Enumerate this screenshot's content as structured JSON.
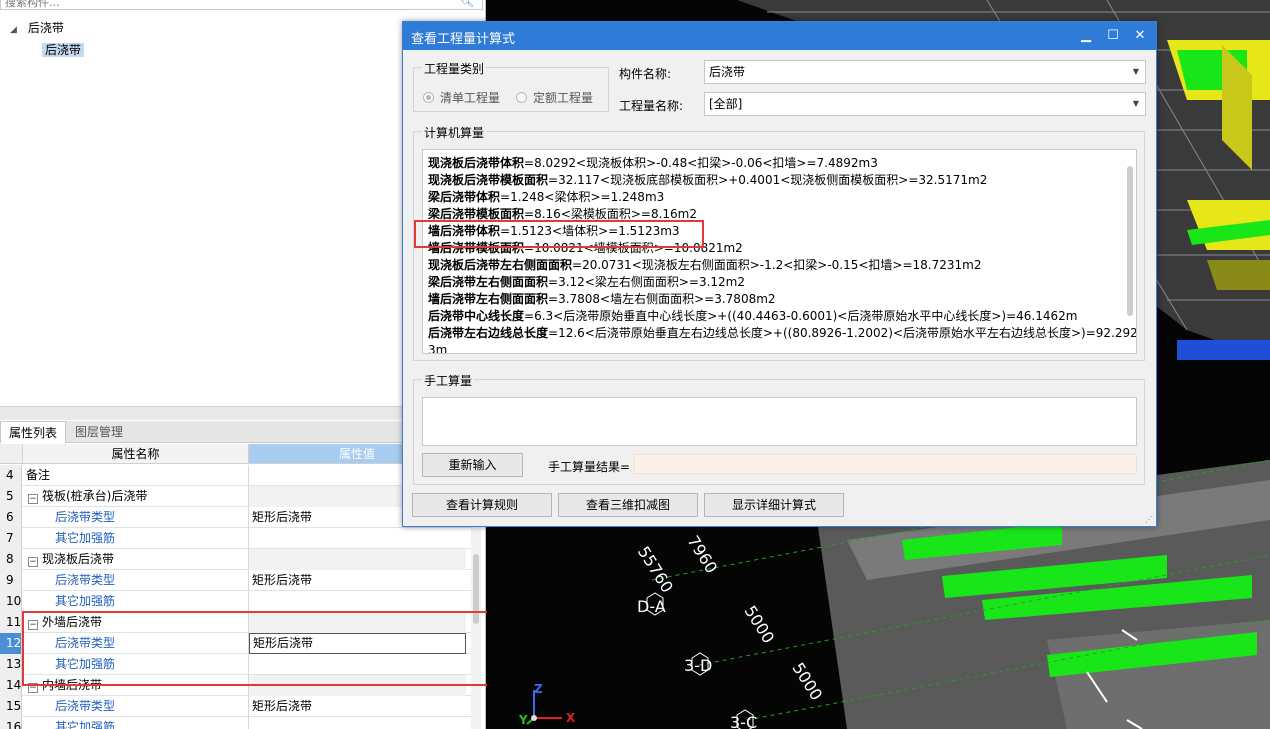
{
  "search": {
    "placeholder": "搜索构件..."
  },
  "tree": {
    "root_label": "后浇带",
    "child_label": "后浇带"
  },
  "tabs": {
    "properties": "属性列表",
    "layers": "图层管理"
  },
  "property_table": {
    "col_name": "属性名称",
    "col_value": "属性值",
    "rows": [
      {
        "num": "4",
        "name": "备注",
        "value": "",
        "kind": "plain"
      },
      {
        "num": "5",
        "name": "筏板(桩承台)后浇带",
        "value": "",
        "kind": "group"
      },
      {
        "num": "6",
        "name": "后浇带类型",
        "value": "矩形后浇带",
        "kind": "child"
      },
      {
        "num": "7",
        "name": "其它加强筋",
        "value": "",
        "kind": "child"
      },
      {
        "num": "8",
        "name": "现浇板后浇带",
        "value": "",
        "kind": "group"
      },
      {
        "num": "9",
        "name": "后浇带类型",
        "value": "矩形后浇带",
        "kind": "child"
      },
      {
        "num": "10",
        "name": "其它加强筋",
        "value": "",
        "kind": "child"
      },
      {
        "num": "11",
        "name": "外墙后浇带",
        "value": "",
        "kind": "group"
      },
      {
        "num": "12",
        "name": "后浇带类型",
        "value": "矩形后浇带",
        "kind": "child-edit"
      },
      {
        "num": "13",
        "name": "其它加强筋",
        "value": "",
        "kind": "child"
      },
      {
        "num": "14",
        "name": "内墙后浇带",
        "value": "",
        "kind": "group"
      },
      {
        "num": "15",
        "name": "后浇带类型",
        "value": "矩形后浇带",
        "kind": "child"
      },
      {
        "num": "16",
        "name": "其它加强筋",
        "value": "",
        "kind": "child"
      }
    ]
  },
  "viewport": {
    "labels": [
      "55760",
      "7960",
      "D-A",
      "5000",
      "3-D",
      "5000",
      "3-C"
    ],
    "axes": {
      "z": "Z",
      "x": "X",
      "y": "Y"
    }
  },
  "dialog": {
    "title": "查看工程量计算式",
    "minimize": "▁",
    "maximize": "☐",
    "close": "✕",
    "quantity_category_label": "工程量类别",
    "radio_list": "清单工程量",
    "radio_quota": "定额工程量",
    "component_name_label": "构件名称:",
    "component_name_value": "后浇带",
    "quantity_name_label": "工程量名称:",
    "quantity_name_value": "[全部]",
    "computer_calc_label": "计算机算量",
    "calc_lines": [
      {
        "term": "现浇板后浇带体积",
        "formula": "=8.0292<现浇板体积>-0.48<扣梁>-0.06<扣墙>=7.4892m3"
      },
      {
        "term": "现浇板后浇带模板面积",
        "formula": "=32.117<现浇板底部模板面积>+0.4001<现浇板侧面模板面积>=32.5171m2"
      },
      {
        "term": "梁后浇带体积",
        "formula": "=1.248<梁体积>=1.248m3"
      },
      {
        "term": "梁后浇带模板面积",
        "formula": "=8.16<梁模板面积>=8.16m2"
      },
      {
        "term": "墙后浇带体积",
        "formula": "=1.5123<墙体积>=1.5123m3"
      },
      {
        "term": "墙后浇带模板面积",
        "formula": "=10.0821<墙模板面积>=10.0821m2"
      },
      {
        "term": "现浇板后浇带左右侧面面积",
        "formula": "=20.0731<现浇板左右侧面面积>-1.2<扣梁>-0.15<扣墙>=18.7231m2"
      },
      {
        "term": "梁后浇带左右侧面面积",
        "formula": "=3.12<梁左右侧面面积>=3.12m2"
      },
      {
        "term": "墙后浇带左右侧面面积",
        "formula": "=3.7808<墙左右侧面面积>=3.7808m2"
      },
      {
        "term": "后浇带中心线长度",
        "formula": "=6.3<后浇带原始垂直中心线长度>+((40.4463-0.6001)<后浇带原始水平中心线长度>)=46.1462m"
      },
      {
        "term": "后浇带左右边线总长度",
        "formula": "=12.6<后浇带原始垂直左右边线总长度>+((80.8926-1.2002)<后浇带原始水平左右边线总长度>)=92.292"
      },
      {
        "term": "",
        "formula": "3m"
      }
    ],
    "manual_calc_label": "手工算量",
    "reenter_button": "重新输入",
    "manual_result_label": "手工算量结果=",
    "view_rules_button": "查看计算规则",
    "view_3d_button": "查看三维扣减图",
    "show_detail_button": "显示详细计算式"
  },
  "colors": {
    "titlebar": "#2f7bd8",
    "highlight_red": "#e03a3a",
    "selected_row": "#4a8fd6",
    "link_blue": "#1f5fbf",
    "model_green": "#19e619",
    "model_yellow": "#e6e619"
  }
}
